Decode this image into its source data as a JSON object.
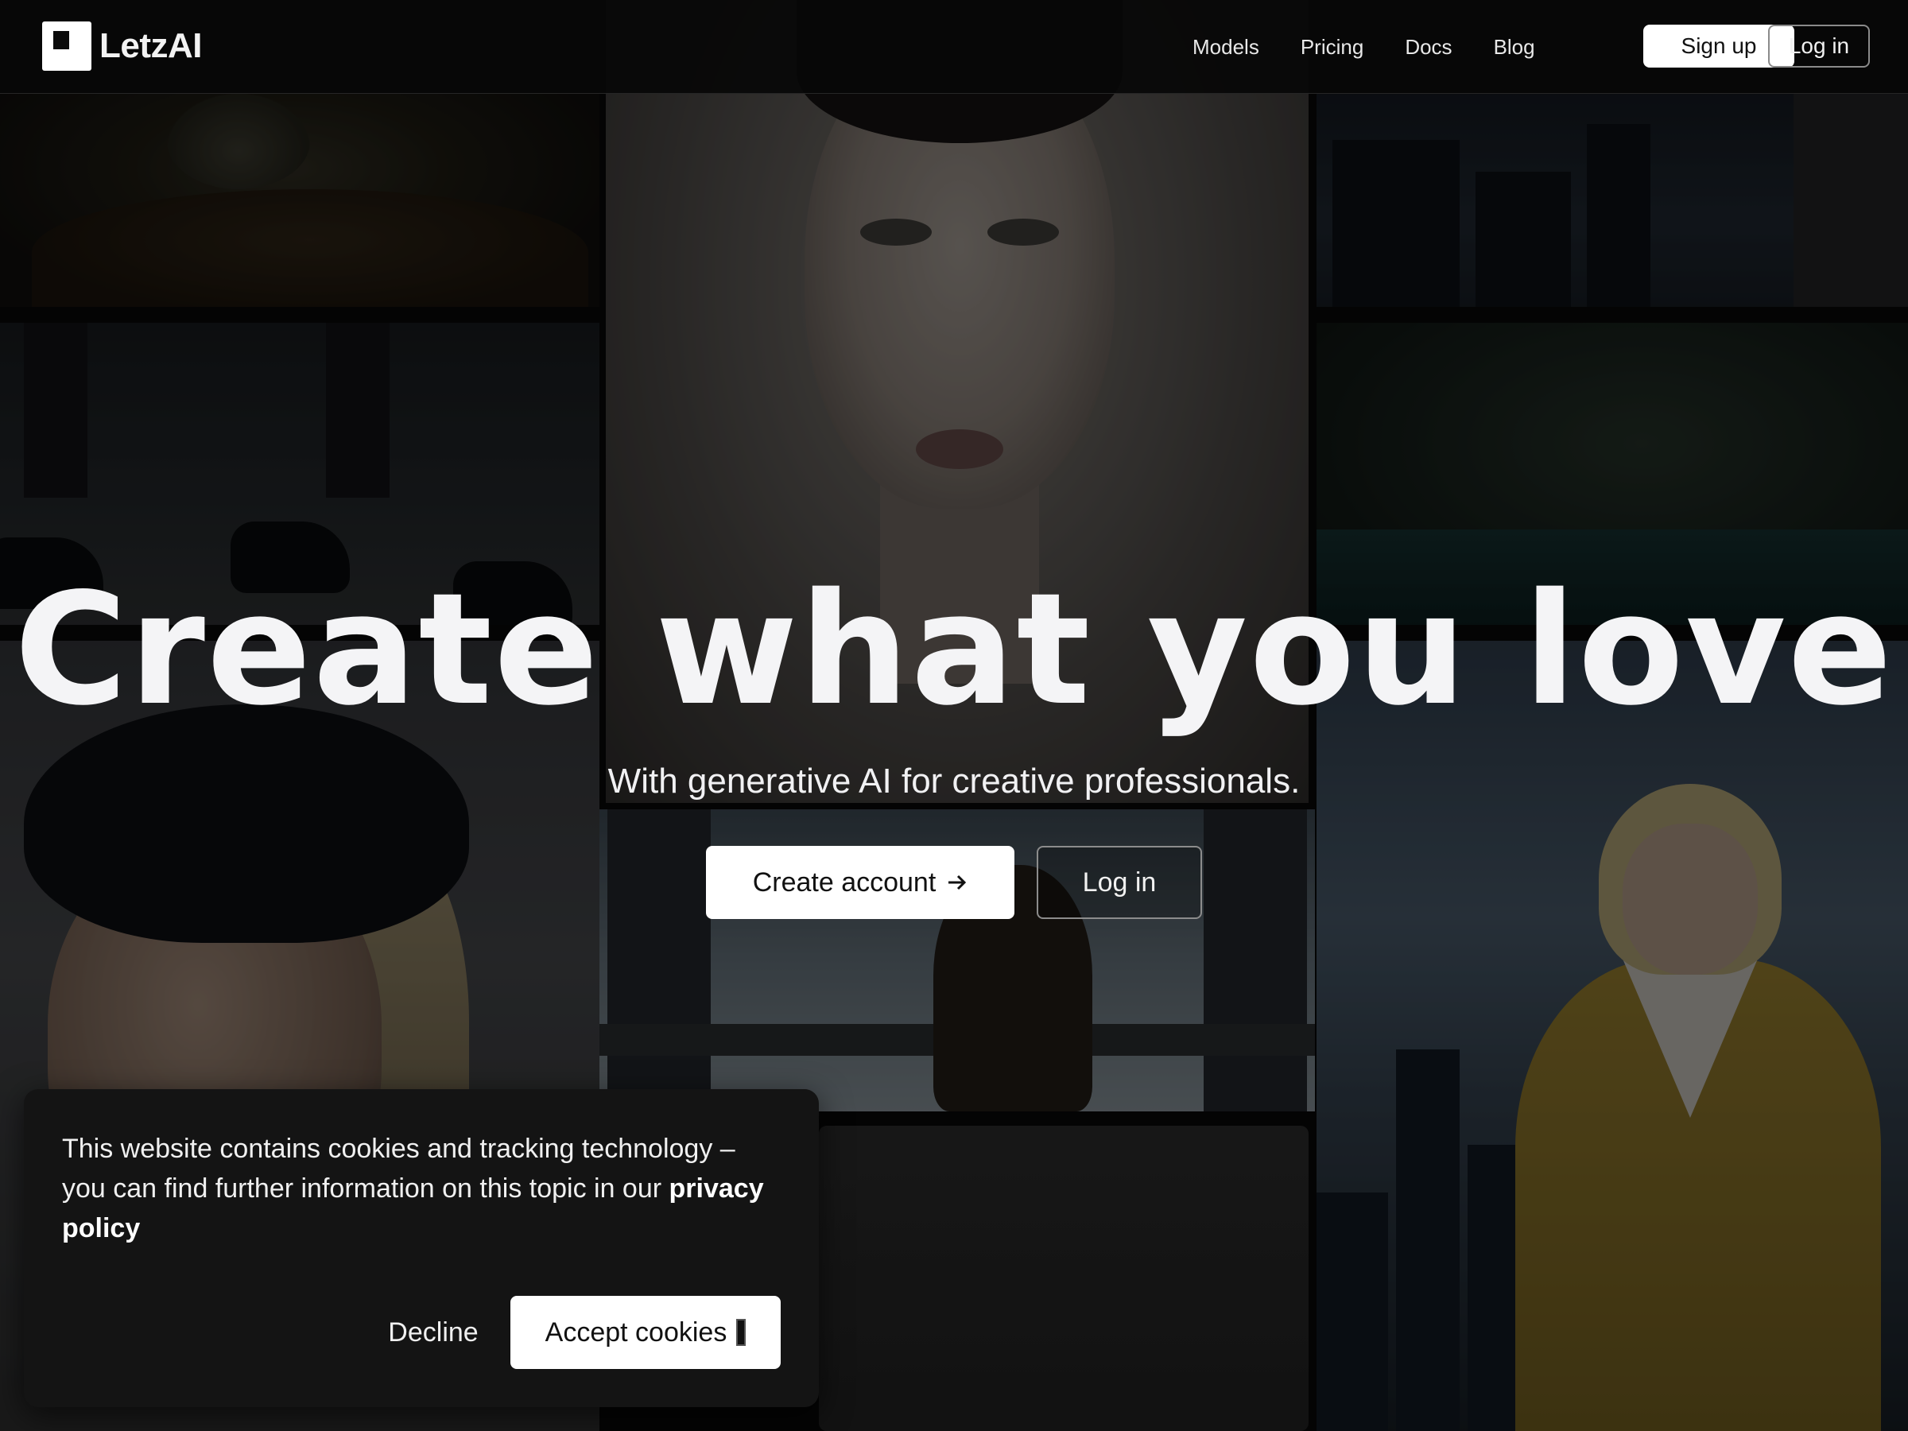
{
  "header": {
    "brand": "LetzAI",
    "nav": [
      {
        "label": "Models"
      },
      {
        "label": "Pricing"
      },
      {
        "label": "Docs"
      },
      {
        "label": "Blog"
      }
    ],
    "signup_label": "Sign up",
    "login_label": "Log in"
  },
  "hero": {
    "title": "Create what you love",
    "subtitle": "With generative AI for creative professionals.",
    "create_account_label": "Create account",
    "create_account_icon": "arrow-right-icon",
    "login_label": "Log in"
  },
  "cookie_banner": {
    "text": "This website contains cookies and tracking technology – you can find further information on this topic in our",
    "link_label": "privacy policy",
    "decline_label": "Decline",
    "accept_label": "Accept cookies",
    "accept_icon": "cookie-icon"
  },
  "colors": {
    "background": "#070707",
    "header_bg": "#080808",
    "button_primary_bg": "#ffffff",
    "button_primary_text": "#111111",
    "banner_bg": "#141414",
    "text_light": "#f4f4f6"
  }
}
